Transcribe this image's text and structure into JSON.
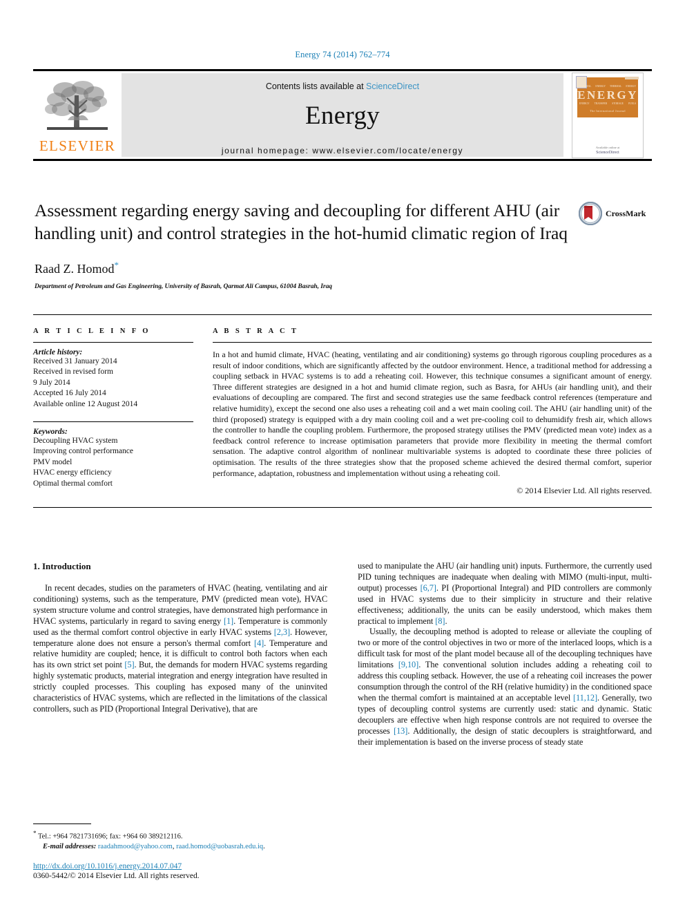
{
  "running_head": "Energy 74 (2014) 762–774",
  "masthead": {
    "publisher_name": "ELSEVIER",
    "contents_prefix": "Contents lists available at ",
    "contents_link": "ScienceDirect",
    "journal_name": "Energy",
    "homepage": "journal homepage: www.elsevier.com/locate/energy",
    "cover": {
      "title": "ENERGY",
      "subtitle": "The International Journal",
      "row_labels_top": [
        "THERMAL",
        "ENERGY",
        "THERMAL",
        "ENERGY"
      ],
      "row_labels_bottom": [
        "ENERGY",
        "TRANSFER",
        "STORAGE",
        "FUELS"
      ],
      "footer": "Available online at",
      "footer_brand": "ScienceDirect"
    }
  },
  "article": {
    "title": "Assessment regarding energy saving and decoupling for different AHU (air handling unit) and control strategies in the hot-humid climatic region of Iraq",
    "author": "Raad Z. Homod",
    "author_marker": "*",
    "affiliation": "Department of Petroleum and Gas Engineering, University of Basrah, Qarmat Ali Campus, 61004 Basrah, Iraq",
    "crossmark_label": "CrossMark"
  },
  "article_info": {
    "heading": "A R T I C L E   I N F O",
    "history_label": "Article history:",
    "history": [
      "Received 31 January 2014",
      "Received in revised form",
      "9 July 2014",
      "Accepted 16 July 2014",
      "Available online 12 August 2014"
    ],
    "keywords_label": "Keywords:",
    "keywords": [
      "Decoupling HVAC system",
      "Improving control performance",
      "PMV model",
      "HVAC energy efficiency",
      "Optimal thermal comfort"
    ]
  },
  "abstract": {
    "heading": "A B S T R A C T",
    "text": "In a hot and humid climate, HVAC (heating, ventilating and air conditioning) systems go through rigorous coupling procedures as a result of indoor conditions, which are significantly affected by the outdoor environment. Hence, a traditional method for addressing a coupling setback in HVAC systems is to add a reheating coil. However, this technique consumes a significant amount of energy. Three different strategies are designed in a hot and humid climate region, such as Basra, for AHUs (air handling unit), and their evaluations of decoupling are compared. The first and second strategies use the same feedback control references (temperature and relative humidity), except the second one also uses a reheating coil and a wet main cooling coil. The AHU (air handling unit) of the third (proposed) strategy is equipped with a dry main cooling coil and a wet pre-cooling coil to dehumidify fresh air, which allows the controller to handle the coupling problem. Furthermore, the proposed strategy utilises the PMV (predicted mean vote) index as a feedback control reference to increase optimisation parameters that provide more flexibility in meeting the thermal comfort sensation. The adaptive control algorithm of nonlinear multivariable systems is adopted to coordinate these three policies of optimisation. The results of the three strategies show that the proposed scheme achieved the desired thermal comfort, superior performance, adaptation, robustness and implementation without using a reheating coil.",
    "copyright": "© 2014 Elsevier Ltd. All rights reserved."
  },
  "body": {
    "section_heading": "1.  Introduction",
    "left_paragraph_1_pre": "In recent decades, studies on the parameters of HVAC (heating, ventilating and air conditioning) systems, such as the temperature, PMV (predicted mean vote), HVAC system structure volume and control strategies, have demonstrated high performance in HVAC systems, particularly in regard to saving energy ",
    "left_ref_1": "[1]",
    "left_p1_b": ". Temperature is commonly used as the thermal comfort control objective in early HVAC systems ",
    "left_ref_2": "[2,3]",
    "left_p1_c": ". However, temperature alone does not ensure a person's thermal comfort ",
    "left_ref_3": "[4]",
    "left_p1_d": ". Temperature and relative humidity are coupled; hence, it is difficult to control both factors when each has its own strict set point ",
    "left_ref_4": "[5]",
    "left_p1_e": ". But, the demands for modern HVAC systems regarding highly systematic products, material integration and energy integration have resulted in strictly coupled processes. This coupling has exposed many of the uninvited characteristics of HVAC systems, which are reflected in the limitations of the classical controllers, such as PID (Proportional Integral Derivative), that are",
    "right_p1_a": "used to manipulate the AHU (air handling unit) inputs. Furthermore, the currently used PID tuning techniques are inadequate when dealing with MIMO (multi-input, multi-output) processes ",
    "right_ref_1": "[6,7]",
    "right_p1_b": ". PI (Proportional Integral) and PID controllers are commonly used in HVAC systems due to their simplicity in structure and their relative effectiveness; additionally, the units can be easily understood, which makes them practical to implement ",
    "right_ref_2": "[8]",
    "right_p1_c": ".",
    "right_p2_a": "Usually, the decoupling method is adopted to release or alleviate the coupling of two or more of the control objectives in two or more of the interlaced loops, which is a difficult task for most of the plant model because all of the decoupling techniques have limitations ",
    "right_ref_3": "[9,10]",
    "right_p2_b": ". The conventional solution includes adding a reheating coil to address this coupling setback. However, the use of a reheating coil increases the power consumption through the control of the RH (relative humidity) in the conditioned space when the thermal comfort is maintained at an acceptable level ",
    "right_ref_4": "[11,12]",
    "right_p2_c": ". Generally, two types of decoupling control systems are currently used: static and dynamic. Static decouplers are effective when high response controls are not required to oversee the processes ",
    "right_ref_5": "[13]",
    "right_p2_d": ". Additionally, the design of static decouplers is straightforward, and their implementation is based on the inverse process of steady state"
  },
  "footnote": {
    "marker": "*",
    "contact": "Tel.: +964 7821731696; fax: +964 60 389212116.",
    "email_label": "E-mail addresses:",
    "email_1": "raadahmood@yahoo.com",
    "email_sep": ", ",
    "email_2": "raad.homod@uobasrah.edu.iq",
    "email_end": "."
  },
  "doi": {
    "url": "http://dx.doi.org/10.1016/j.energy.2014.07.047",
    "issn_line": "0360-5442/© 2014 Elsevier Ltd. All rights reserved."
  },
  "colors": {
    "link_blue": "#1a7fb5",
    "elsevier_orange": "#f07f13",
    "cover_orange": "#cf7d2a",
    "masthead_gray": "#e3e3e3"
  }
}
